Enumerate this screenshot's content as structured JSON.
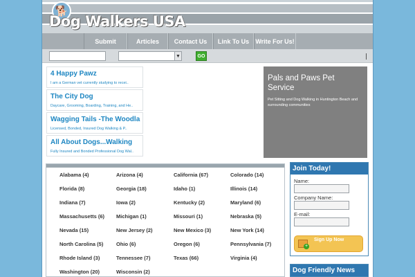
{
  "logo": {
    "text": "Dog Walkers USA"
  },
  "nav": [
    {
      "label": "Submit"
    },
    {
      "label": "Articles"
    },
    {
      "label": "Contact Us"
    },
    {
      "label": "Link To Us"
    },
    {
      "label": "Write For Us!"
    }
  ],
  "search": {
    "input_value": "",
    "select_value": "",
    "go_label": "GO"
  },
  "listings": [
    {
      "title": "4 Happy Pawz",
      "desc": "I am a German vet currently studying to recei.."
    },
    {
      "title": "The City Dog",
      "desc": "Daycare, Grooming, Boarding, Training, and He.."
    },
    {
      "title": "Wagging Tails -The Woodla",
      "desc": "Licensed, Bonded, Insured Dog Walking & P.."
    },
    {
      "title": "All About Dogs...Walking",
      "desc": "Fully Insured and Bonded Professional Dog Wal.."
    }
  ],
  "featured": {
    "title": "Pals and Paws Pet Service",
    "desc": "Pet Sitting and Dog Walking in Huntington Beach and surrounding communities"
  },
  "states": [
    "Alabama (4)",
    "Arizona (4)",
    "California (67)",
    "Colorado (14)",
    "Florida (8)",
    "Georgia (18)",
    "Idaho (1)",
    "Illinois (14)",
    "Indiana (7)",
    "Iowa (2)",
    "Kentucky (2)",
    "Maryland (6)",
    "Massachusetts (6)",
    "Michigan (1)",
    "Missouri (1)",
    "Nebraska (5)",
    "Nevada (15)",
    "New Jersey (2)",
    "New Mexico (3)",
    "New York (14)",
    "North Carolina (5)",
    "Ohio (6)",
    "Oregon (6)",
    "Pennsylvania (7)",
    "Rhode Island (3)",
    "Tennessee (7)",
    "Texas (66)",
    "Virginia (4)",
    "Washington (20)",
    "Wisconsin (2)"
  ],
  "join": {
    "title": "Join Today!",
    "name_label": "Name:",
    "company_label": "Company Name:",
    "email_label": "E-mail:",
    "signup_label": "Sign Up Now"
  },
  "news": {
    "title": "Dog Friendly News"
  },
  "colors": {
    "background": "#7ab8dc",
    "link": "#1d86c2",
    "header_blue": "#2f77b0",
    "go_green": "#3fae2e",
    "featured_gray": "#808080"
  }
}
